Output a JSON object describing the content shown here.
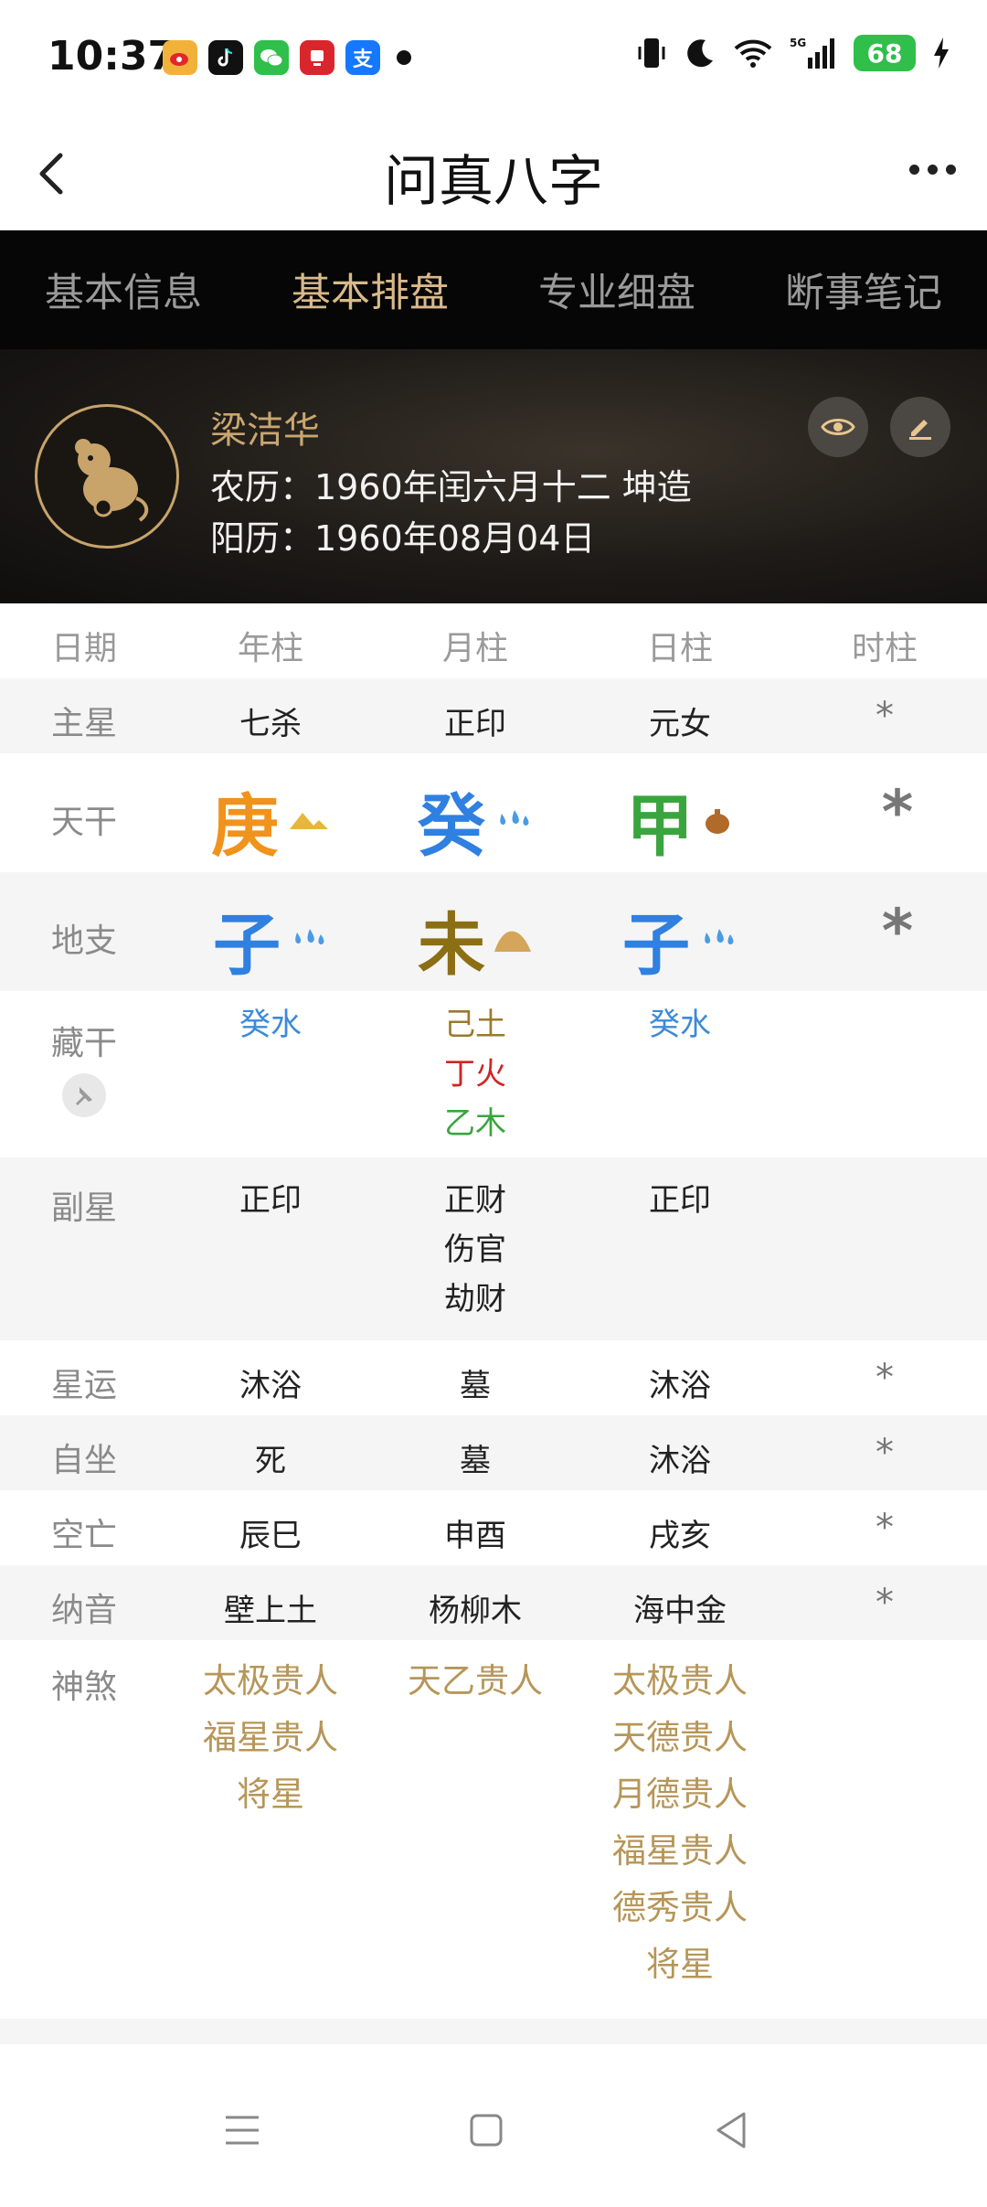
{
  "status": {
    "time": "10:37",
    "battery": "68",
    "alipay_glyph": "支"
  },
  "app": {
    "title": "问真八字"
  },
  "tabs": [
    {
      "label": "基本信息",
      "active": false
    },
    {
      "label": "基本排盘",
      "active": true
    },
    {
      "label": "专业细盘",
      "active": false
    },
    {
      "label": "断事笔记",
      "active": false
    }
  ],
  "profile": {
    "name": "梁洁华",
    "lunar": "农历：1960年闰六月十二 坤造",
    "solar": "阳历：1960年08月04日"
  },
  "table": {
    "headers": [
      "日期",
      "年柱",
      "月柱",
      "日柱",
      "时柱"
    ],
    "main_star": {
      "label": "主星",
      "values": [
        "七杀",
        "正印",
        "元女",
        "*"
      ]
    },
    "tiangan": {
      "label": "天干",
      "values": [
        "庚",
        "癸",
        "甲",
        "*"
      ]
    },
    "dizhi": {
      "label": "地支",
      "values": [
        "子",
        "未",
        "子",
        "*"
      ]
    },
    "canggan": {
      "label": "藏干",
      "cols": [
        [
          "癸水"
        ],
        [
          "己土",
          "丁火",
          "乙木"
        ],
        [
          "癸水"
        ]
      ]
    },
    "fuxing": {
      "label": "副星",
      "cols": [
        [
          "正印"
        ],
        [
          "正财",
          "伤官",
          "劫财"
        ],
        [
          "正印"
        ]
      ]
    },
    "xingyun": {
      "label": "星运",
      "values": [
        "沐浴",
        "墓",
        "沐浴",
        "*"
      ]
    },
    "zizuo": {
      "label": "自坐",
      "values": [
        "死",
        "墓",
        "沐浴",
        "*"
      ]
    },
    "kongwang": {
      "label": "空亡",
      "values": [
        "辰巳",
        "申酉",
        "戌亥",
        "*"
      ]
    },
    "nayin": {
      "label": "纳音",
      "values": [
        "壁上土",
        "杨柳木",
        "海中金",
        "*"
      ]
    },
    "shensha": {
      "label": "神煞",
      "cols": [
        [
          "太极贵人",
          "福星贵人",
          "将星"
        ],
        [
          "天乙贵人"
        ],
        [
          "太极贵人",
          "天德贵人",
          "月德贵人",
          "福星贵人",
          "德秀贵人",
          "将星"
        ]
      ]
    }
  },
  "colors": {
    "accent": "#d9b98b",
    "metal": "#f0931c",
    "water": "#2f80e0",
    "wood": "#3aa53f",
    "earth": "#8c6e14",
    "shensha": "#b69658"
  },
  "icons": [
    "back-icon",
    "more-icon",
    "eye-icon",
    "edit-icon",
    "pin-icon",
    "menu-icon",
    "home-icon",
    "back-triangle-icon"
  ]
}
